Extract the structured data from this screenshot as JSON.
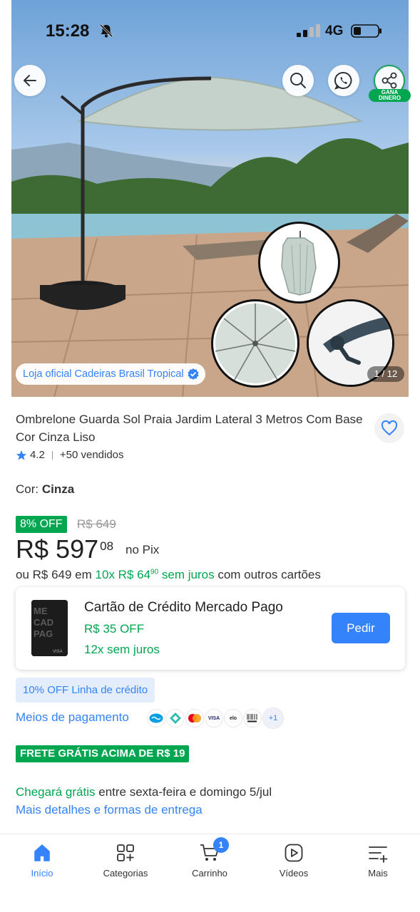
{
  "status_bar": {
    "time": "15:28",
    "network": "4G"
  },
  "gallery": {
    "store_label": "Loja oficial Cadeiras Brasil Tropical",
    "counter": "1 / 12",
    "share_badge_line1": "GANA",
    "share_badge_line2": "DINERO"
  },
  "product": {
    "title": "Ombrelone Guarda Sol Praia Jardim Lateral 3 Metros Com Base Cor Cinza Liso",
    "rating": "4.2",
    "sold": "+50 vendidos",
    "color_label": "Cor:",
    "color_value": "Cinza"
  },
  "price": {
    "discount": "8% OFF",
    "old": "R$ 649",
    "currency": "R$",
    "integer": "597",
    "cents": "08",
    "pix_label": "no Pix",
    "install_prefix": "ou R$ 649 em",
    "install_green": "10x R$ 64",
    "install_cents": "90",
    "install_interest": "sem juros",
    "install_suffix": "com outros cartões"
  },
  "credit_card_offer": {
    "title": "Cartão de Crédito Mercado Pago",
    "discount": "R$ 35 OFF",
    "installments": "12x sem juros",
    "button": "Pedir"
  },
  "credit_line": "10% OFF Linha de crédito",
  "payment": {
    "link": "Meios de pagamento",
    "more": "+1"
  },
  "shipping": {
    "badge": "FRETE GRÁTIS ACIMA DE R$ 19",
    "arrival_green": "Chegará grátis",
    "arrival_rest": "entre sexta-feira e domingo 5/jul",
    "details_link": "Mais detalhes e formas de entrega"
  },
  "bottom_nav": {
    "items": [
      {
        "label": "Início",
        "icon": "home-icon"
      },
      {
        "label": "Categorias",
        "icon": "categories-icon"
      },
      {
        "label": "Carrinho",
        "icon": "cart-icon",
        "badge": "1"
      },
      {
        "label": "Vídeos",
        "icon": "video-icon"
      },
      {
        "label": "Mais",
        "icon": "menu-icon"
      }
    ]
  },
  "colors": {
    "accent": "#3483fa",
    "green": "#00a650"
  }
}
